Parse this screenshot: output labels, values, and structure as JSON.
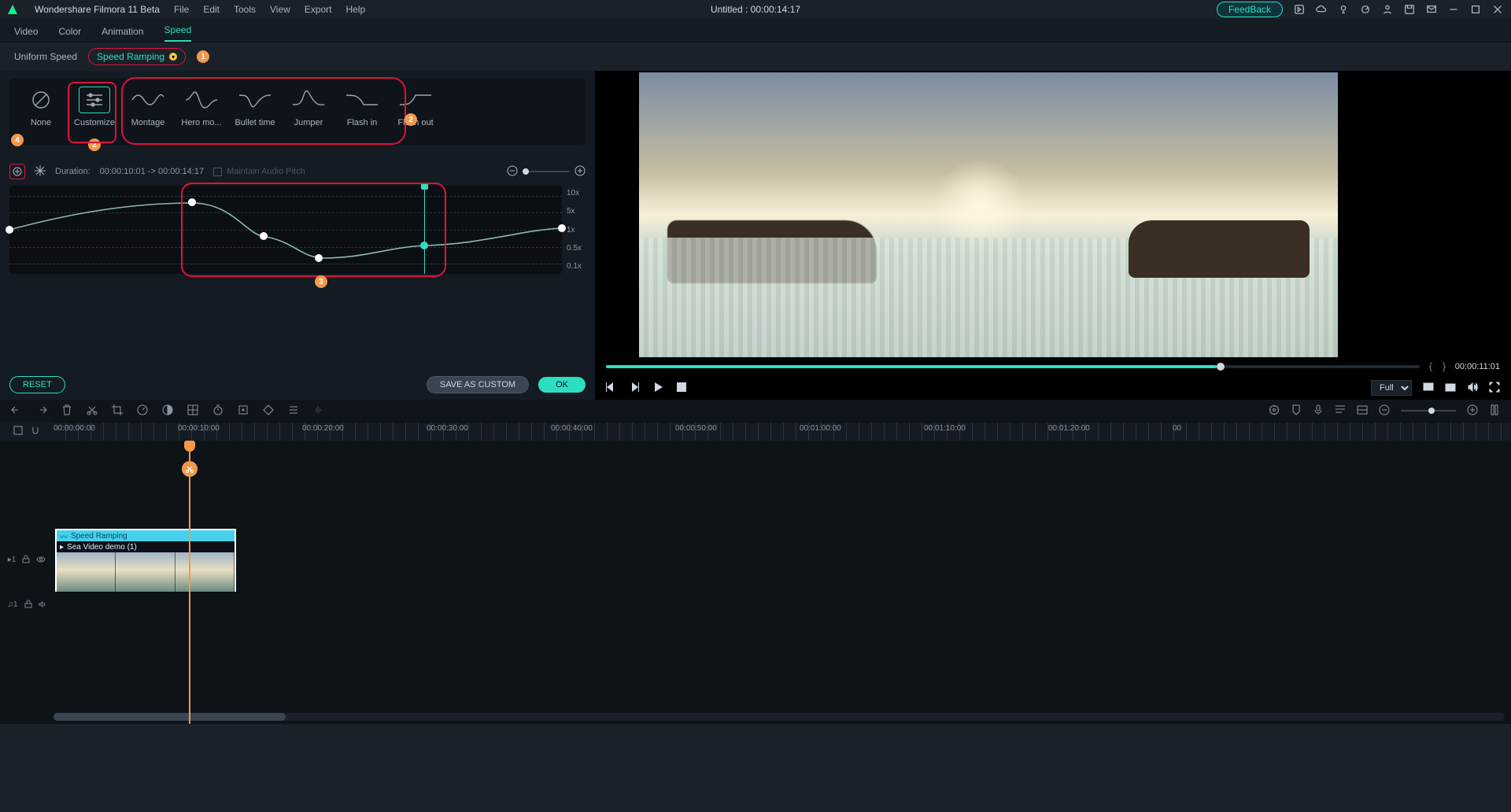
{
  "app": {
    "name": "Wondershare Filmora 11 Beta"
  },
  "menus": {
    "file": "File",
    "edit": "Edit",
    "tools": "Tools",
    "view": "View",
    "export": "Export",
    "help": "Help"
  },
  "title": "Untitled : 00:00:14:17",
  "topbar": {
    "feedback": "FeedBack"
  },
  "panel_tabs": {
    "video": "Video",
    "color": "Color",
    "animation": "Animation",
    "speed": "Speed"
  },
  "speed_sub": {
    "uniform": "Uniform Speed",
    "ramping": "Speed Ramping"
  },
  "badges": {
    "one": "1",
    "two": "2",
    "three": "3",
    "four": "4"
  },
  "presets": {
    "none": "None",
    "customize": "Customize",
    "montage": "Montage",
    "hero": "Hero mo...",
    "bullet": "Bullet time",
    "jumper": "Jumper",
    "flashin": "Flash in",
    "flashout": "Flash out"
  },
  "duration": {
    "label": "Duration:",
    "value": "00:00:10:01 -> 00:00:14:17",
    "maintain": "Maintain Audio Pitch"
  },
  "ylabels": {
    "x10": "10x",
    "x5": "5x",
    "x1": "1x",
    "x05": "0.5x",
    "x01": "0.1x"
  },
  "buttons": {
    "reset": "RESET",
    "save": "SAVE AS CUSTOM",
    "ok": "OK"
  },
  "preview": {
    "time": "00:00:11:01",
    "mode": "Full"
  },
  "ruler": {
    "t0": "00:00:00:00",
    "t10": "00:00:10:00",
    "t20": "00:00:20:00",
    "t30": "00:00:30:00",
    "t40": "00:00:40:00",
    "t50": "00:00:50:00",
    "t60": "00:01:00:00",
    "t70": "00:01:10:00",
    "t80": "00:01:20:00",
    "t90": "00"
  },
  "track": {
    "video_id": "1",
    "audio_id": "1"
  },
  "clip": {
    "fx": "Speed Ramping",
    "name": "Sea Video demo (1)"
  },
  "audio_sym": "♫"
}
